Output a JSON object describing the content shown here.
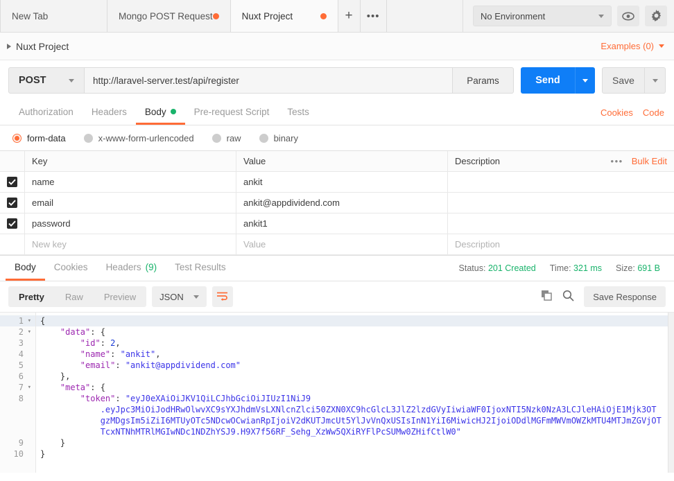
{
  "tabbar": {
    "tabs": [
      {
        "label": "New Tab",
        "dirty": false,
        "active": false
      },
      {
        "label": "Mongo POST Request",
        "dirty": true,
        "active": false
      },
      {
        "label": "Nuxt Project",
        "dirty": true,
        "active": true
      }
    ],
    "new_tab_label": "+",
    "more_label": "•••",
    "environment": "No Environment",
    "eye_icon": "eye-icon",
    "settings_icon": "gear-icon"
  },
  "breadcrumb": {
    "title": "Nuxt Project",
    "examples_label": "Examples (0)"
  },
  "request": {
    "method": "POST",
    "url": "http://laravel-server.test/api/register",
    "params_label": "Params",
    "send_label": "Send",
    "save_label": "Save",
    "tabs": [
      {
        "label": "Authorization",
        "active": false,
        "dot": false
      },
      {
        "label": "Headers",
        "active": false,
        "dot": false
      },
      {
        "label": "Body",
        "active": true,
        "dot": true
      },
      {
        "label": "Pre-request Script",
        "active": false,
        "dot": false
      },
      {
        "label": "Tests",
        "active": false,
        "dot": false
      }
    ],
    "cookies_link": "Cookies",
    "code_link": "Code",
    "body_types": [
      {
        "label": "form-data",
        "selected": true
      },
      {
        "label": "x-www-form-urlencoded",
        "selected": false
      },
      {
        "label": "raw",
        "selected": false
      },
      {
        "label": "binary",
        "selected": false
      }
    ]
  },
  "kvtable": {
    "headers": {
      "key": "Key",
      "value": "Value",
      "description": "Description"
    },
    "more_label": "•••",
    "bulk_edit_label": "Bulk Edit",
    "rows": [
      {
        "checked": true,
        "key": "name",
        "value": "ankit",
        "description": ""
      },
      {
        "checked": true,
        "key": "email",
        "value": "ankit@appdividend.com",
        "description": ""
      },
      {
        "checked": true,
        "key": "password",
        "value": "ankit1",
        "description": ""
      }
    ],
    "new_row": {
      "key_placeholder": "New key",
      "value_placeholder": "Value",
      "desc_placeholder": "Description"
    }
  },
  "response": {
    "tabs": [
      {
        "label": "Body",
        "active": true,
        "count": ""
      },
      {
        "label": "Cookies",
        "active": false,
        "count": ""
      },
      {
        "label": "Headers",
        "active": false,
        "count": "(9)"
      },
      {
        "label": "Test Results",
        "active": false,
        "count": ""
      }
    ],
    "status_label": "Status:",
    "status_value": "201 Created",
    "time_label": "Time:",
    "time_value": "321 ms",
    "size_label": "Size:",
    "size_value": "691 B",
    "view_modes": [
      {
        "label": "Pretty",
        "active": true
      },
      {
        "label": "Raw",
        "active": false
      },
      {
        "label": "Preview",
        "active": false
      }
    ],
    "format": "JSON",
    "wrap_icon": "word-wrap-icon",
    "copy_icon": "copy-icon",
    "search_icon": "search-icon",
    "save_response_label": "Save Response"
  },
  "code": {
    "line_numbers": [
      "1",
      "2",
      "3",
      "4",
      "5",
      "6",
      "7",
      "8",
      "",
      "9",
      "10"
    ],
    "lines": [
      {
        "n": "1",
        "fold": true,
        "tokens": [
          {
            "t": "{",
            "c": "p"
          }
        ]
      },
      {
        "n": "2",
        "fold": true,
        "tokens": [
          {
            "t": "    ",
            "c": "p"
          },
          {
            "t": "\"data\"",
            "c": "k"
          },
          {
            "t": ": {",
            "c": "p"
          }
        ]
      },
      {
        "n": "3",
        "fold": false,
        "tokens": [
          {
            "t": "        ",
            "c": "p"
          },
          {
            "t": "\"id\"",
            "c": "k"
          },
          {
            "t": ": ",
            "c": "p"
          },
          {
            "t": "2",
            "c": "n"
          },
          {
            "t": ",",
            "c": "p"
          }
        ]
      },
      {
        "n": "4",
        "fold": false,
        "tokens": [
          {
            "t": "        ",
            "c": "p"
          },
          {
            "t": "\"name\"",
            "c": "k"
          },
          {
            "t": ": ",
            "c": "p"
          },
          {
            "t": "\"ankit\"",
            "c": "s"
          },
          {
            "t": ",",
            "c": "p"
          }
        ]
      },
      {
        "n": "5",
        "fold": false,
        "tokens": [
          {
            "t": "        ",
            "c": "p"
          },
          {
            "t": "\"email\"",
            "c": "k"
          },
          {
            "t": ": ",
            "c": "p"
          },
          {
            "t": "\"ankit@appdividend.com\"",
            "c": "s"
          }
        ]
      },
      {
        "n": "6",
        "fold": false,
        "tokens": [
          {
            "t": "    },",
            "c": "p"
          }
        ]
      },
      {
        "n": "7",
        "fold": true,
        "tokens": [
          {
            "t": "    ",
            "c": "p"
          },
          {
            "t": "\"meta\"",
            "c": "k"
          },
          {
            "t": ": {",
            "c": "p"
          }
        ]
      },
      {
        "n": "8",
        "fold": false,
        "tokens": [
          {
            "t": "        ",
            "c": "p"
          },
          {
            "t": "\"token\"",
            "c": "k"
          },
          {
            "t": ": ",
            "c": "p"
          },
          {
            "t": "\"eyJ0eXAiOiJKV1QiLCJhbGciOiJIUzI1NiJ9",
            "c": "s"
          }
        ]
      },
      {
        "n": "",
        "fold": false,
        "tokens": [
          {
            "t": "            ",
            "c": "p"
          },
          {
            "t": ".eyJpc3MiOiJodHRwOlwvXC9sYXJhdmVsLXNlcnZlci50ZXN0XC9hcGlcL3JlZ2lzdGVyIiwiaWF0IjoxNTI5Nzk0NzA3LCJleHAiOjE1Mjk3OT",
            "c": "s"
          }
        ]
      },
      {
        "n": "",
        "fold": false,
        "tokens": [
          {
            "t": "            ",
            "c": "p"
          },
          {
            "t": "gzMDgsIm5iZiI6MTUyOTc5NDcwOCwianRpIjoiV2dKUTJmcUt5YlJvVnQxUSIsInN1YiI6MiwicHJ2IjoiODdlMGFmMWVmOWZkMTU4MTJmZGVjOT",
            "c": "s"
          }
        ]
      },
      {
        "n": "",
        "fold": false,
        "tokens": [
          {
            "t": "            ",
            "c": "p"
          },
          {
            "t": "TcxNTNhMTRlMGIwNDc1NDZhYSJ9.H9X7f56RF_Sehg_XzWw5QXiRYFlPcSUMw0ZHifCtlW0\"",
            "c": "s"
          }
        ]
      },
      {
        "n": "9",
        "fold": false,
        "tokens": [
          {
            "t": "    }",
            "c": "p"
          }
        ]
      },
      {
        "n": "10",
        "fold": false,
        "tokens": [
          {
            "t": "}",
            "c": "p"
          }
        ]
      }
    ]
  }
}
